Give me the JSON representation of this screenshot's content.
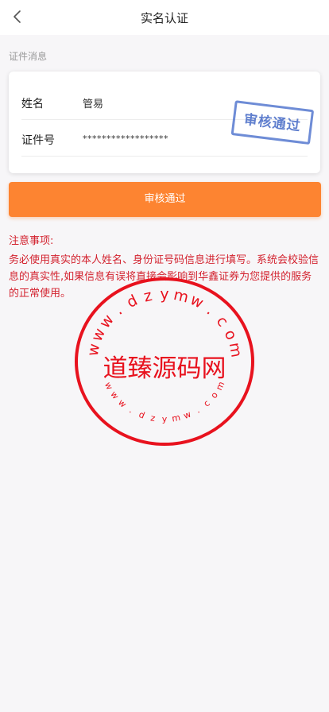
{
  "nav": {
    "title": "实名认证"
  },
  "section": {
    "label": "证件消息"
  },
  "card": {
    "name_label": "姓名",
    "name_value": "管易",
    "id_label": "证件号",
    "id_value": "******************",
    "stamp_text": "审核通过"
  },
  "button": {
    "label": "审核通过"
  },
  "notice": {
    "title": "注意事项:",
    "text": "务必使用真实的本人姓名、身份证号码信息进行填写。系统会校验信息的真实性,如果信息有误将直接会影响到华鑫证券为您提供的服务的正常使用。"
  },
  "watermark": {
    "center_text": "道臻源码网",
    "ring_text_top": "www.dzymw.com",
    "ring_text_bottom": "www.dzymw.com"
  },
  "colors": {
    "accent": "#fd8431",
    "notice": "#d3232f",
    "stamp": "#4f72c9",
    "watermark": "#e8121e"
  },
  "icons": {
    "back": "chevron-left-icon"
  }
}
